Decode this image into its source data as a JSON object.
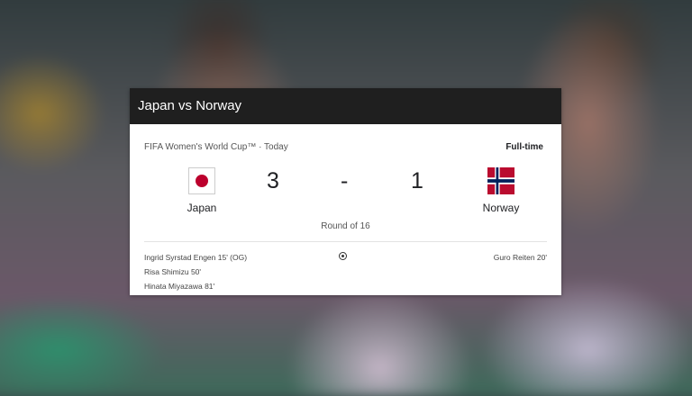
{
  "match": {
    "title": "Japan vs Norway",
    "competition": "FIFA Women's World Cup™ · Today",
    "status": "Full-time",
    "round": "Round of 16",
    "home": {
      "name": "Japan",
      "score": "3",
      "flag_icon": "japan-flag-icon",
      "flag_color": "#bc002d"
    },
    "away": {
      "name": "Norway",
      "score": "1",
      "flag_icon": "norway-flag-icon",
      "flag_colors": [
        "#ba0c2f",
        "#ffffff",
        "#00205b"
      ]
    },
    "separator": "-",
    "home_scorers": [
      "Ingrid Syrstad Engen 15' (OG)",
      "Risa Shimizu 50'",
      "Hinata Miyazawa 81'"
    ],
    "away_scorers": [
      "Guro Reiten 20'"
    ]
  }
}
